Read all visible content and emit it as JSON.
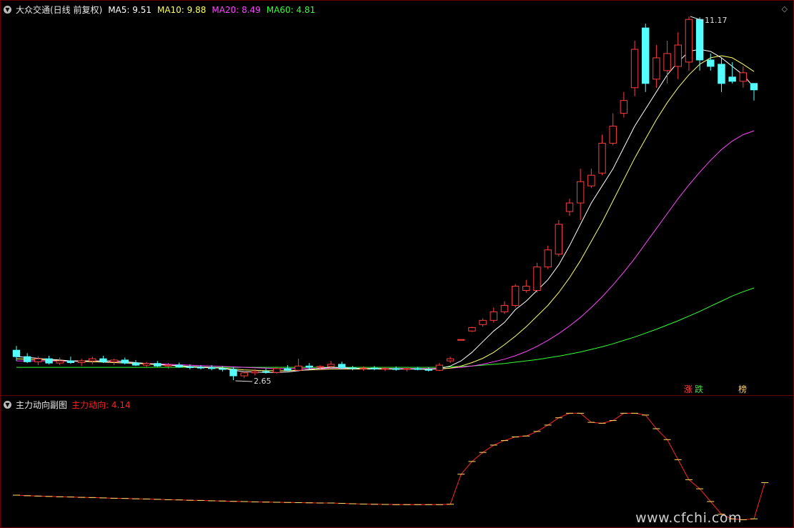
{
  "main": {
    "title": "大众交通(日线 前复权)",
    "ma": [
      {
        "label": "MA5: 9.51",
        "color": "#ffffff"
      },
      {
        "label": "MA10: 9.88",
        "color": "#ffff66"
      },
      {
        "label": "MA20: 8.49",
        "color": "#ff44ff"
      },
      {
        "label": "MA60: 4.81",
        "color": "#33ff33"
      }
    ],
    "high_label": "11.17",
    "low_label": "2.65",
    "badges": [
      {
        "text": "涨",
        "color": "#ff4444"
      },
      {
        "text": "跌",
        "color": "#44dd44"
      },
      {
        "text": "榜",
        "color": "#ffcc66"
      }
    ],
    "corner_icon": "diamond-icon"
  },
  "sub": {
    "title": "主力动向副图",
    "indicator_label": "主力动向: 4.14",
    "indicator_color": "#ff2222"
  },
  "watermark": "www.cfchi.com",
  "colors": {
    "up": "#ff3c3c",
    "down": "#54ffff",
    "border": "#6a0000"
  },
  "chart_data": {
    "type": "candlestick",
    "price_range": [
      2.65,
      11.17
    ],
    "candles": [
      {
        "o": 3.35,
        "h": 3.45,
        "l": 3.1,
        "c": 3.2
      },
      {
        "o": 3.2,
        "h": 3.28,
        "l": 3.05,
        "c": 3.08
      },
      {
        "o": 3.08,
        "h": 3.2,
        "l": 3.0,
        "c": 3.15
      },
      {
        "o": 3.15,
        "h": 3.22,
        "l": 3.02,
        "c": 3.05
      },
      {
        "o": 3.05,
        "h": 3.18,
        "l": 3.0,
        "c": 3.1
      },
      {
        "o": 3.1,
        "h": 3.2,
        "l": 3.03,
        "c": 3.06
      },
      {
        "o": 3.06,
        "h": 3.15,
        "l": 2.98,
        "c": 3.1
      },
      {
        "o": 3.1,
        "h": 3.2,
        "l": 3.02,
        "c": 3.15
      },
      {
        "o": 3.15,
        "h": 3.22,
        "l": 3.05,
        "c": 3.08
      },
      {
        "o": 3.08,
        "h": 3.15,
        "l": 3.0,
        "c": 3.12
      },
      {
        "o": 3.12,
        "h": 3.18,
        "l": 3.02,
        "c": 3.05
      },
      {
        "o": 3.05,
        "h": 3.12,
        "l": 2.98,
        "c": 3.0
      },
      {
        "o": 3.0,
        "h": 3.08,
        "l": 2.95,
        "c": 3.04
      },
      {
        "o": 3.04,
        "h": 3.1,
        "l": 2.96,
        "c": 2.98
      },
      {
        "o": 2.98,
        "h": 3.05,
        "l": 2.92,
        "c": 3.0
      },
      {
        "o": 3.0,
        "h": 3.06,
        "l": 2.94,
        "c": 2.96
      },
      {
        "o": 2.96,
        "h": 3.02,
        "l": 2.9,
        "c": 2.95
      },
      {
        "o": 2.95,
        "h": 3.0,
        "l": 2.9,
        "c": 2.94
      },
      {
        "o": 2.94,
        "h": 3.0,
        "l": 2.88,
        "c": 2.92
      },
      {
        "o": 2.92,
        "h": 2.98,
        "l": 2.85,
        "c": 2.9
      },
      {
        "o": 2.9,
        "h": 2.95,
        "l": 2.65,
        "c": 2.75
      },
      {
        "o": 2.75,
        "h": 2.85,
        "l": 2.7,
        "c": 2.82
      },
      {
        "o": 2.82,
        "h": 2.9,
        "l": 2.76,
        "c": 2.85
      },
      {
        "o": 2.85,
        "h": 2.92,
        "l": 2.8,
        "c": 2.83
      },
      {
        "o": 2.83,
        "h": 2.95,
        "l": 2.8,
        "c": 2.92
      },
      {
        "o": 2.92,
        "h": 3.0,
        "l": 2.86,
        "c": 2.88
      },
      {
        "o": 2.88,
        "h": 3.15,
        "l": 2.85,
        "c": 2.98
      },
      {
        "o": 2.98,
        "h": 3.05,
        "l": 2.9,
        "c": 2.95
      },
      {
        "o": 2.95,
        "h": 3.0,
        "l": 2.88,
        "c": 2.97
      },
      {
        "o": 2.97,
        "h": 3.1,
        "l": 2.92,
        "c": 3.02
      },
      {
        "o": 3.02,
        "h": 3.08,
        "l": 2.9,
        "c": 2.94
      },
      {
        "o": 2.94,
        "h": 2.98,
        "l": 2.88,
        "c": 2.92
      },
      {
        "o": 2.92,
        "h": 2.97,
        "l": 2.87,
        "c": 2.93
      },
      {
        "o": 2.93,
        "h": 2.98,
        "l": 2.88,
        "c": 2.91
      },
      {
        "o": 2.91,
        "h": 2.96,
        "l": 2.86,
        "c": 2.92
      },
      {
        "o": 2.92,
        "h": 2.97,
        "l": 2.87,
        "c": 2.9
      },
      {
        "o": 2.9,
        "h": 2.95,
        "l": 2.85,
        "c": 2.92
      },
      {
        "o": 2.92,
        "h": 2.96,
        "l": 2.88,
        "c": 2.9
      },
      {
        "o": 2.9,
        "h": 2.95,
        "l": 2.85,
        "c": 2.88
      },
      {
        "o": 2.88,
        "h": 3.05,
        "l": 2.86,
        "c": 3.0
      },
      {
        "o": 3.1,
        "h": 3.2,
        "l": 3.05,
        "c": 3.15
      },
      {
        "o": 3.6,
        "h": 3.6,
        "l": 3.6,
        "c": 3.6
      },
      {
        "o": 3.8,
        "h": 3.9,
        "l": 3.78,
        "c": 3.88
      },
      {
        "o": 3.95,
        "h": 4.1,
        "l": 3.9,
        "c": 4.05
      },
      {
        "o": 4.05,
        "h": 4.35,
        "l": 4.0,
        "c": 4.25
      },
      {
        "o": 4.25,
        "h": 4.5,
        "l": 4.2,
        "c": 4.4
      },
      {
        "o": 4.4,
        "h": 4.9,
        "l": 4.35,
        "c": 4.85
      },
      {
        "o": 4.75,
        "h": 5.0,
        "l": 4.7,
        "c": 4.85
      },
      {
        "o": 4.75,
        "h": 5.4,
        "l": 4.7,
        "c": 5.3
      },
      {
        "o": 5.3,
        "h": 5.8,
        "l": 5.25,
        "c": 5.7
      },
      {
        "o": 5.6,
        "h": 6.4,
        "l": 5.55,
        "c": 6.3
      },
      {
        "o": 6.6,
        "h": 6.9,
        "l": 6.5,
        "c": 6.8
      },
      {
        "o": 6.8,
        "h": 7.6,
        "l": 6.4,
        "c": 7.3
      },
      {
        "o": 7.2,
        "h": 7.6,
        "l": 7.15,
        "c": 7.45
      },
      {
        "o": 7.5,
        "h": 8.4,
        "l": 7.45,
        "c": 8.2
      },
      {
        "o": 8.2,
        "h": 8.9,
        "l": 8.15,
        "c": 8.6
      },
      {
        "o": 8.9,
        "h": 9.4,
        "l": 8.8,
        "c": 9.2
      },
      {
        "o": 9.5,
        "h": 10.6,
        "l": 9.3,
        "c": 10.4
      },
      {
        "o": 10.9,
        "h": 11.0,
        "l": 9.4,
        "c": 9.6
      },
      {
        "o": 9.7,
        "h": 10.5,
        "l": 9.5,
        "c": 10.2
      },
      {
        "o": 9.9,
        "h": 10.6,
        "l": 9.6,
        "c": 10.3
      },
      {
        "o": 10.0,
        "h": 10.8,
        "l": 9.7,
        "c": 10.5
      },
      {
        "o": 10.1,
        "h": 11.17,
        "l": 9.9,
        "c": 11.1
      },
      {
        "o": 11.1,
        "h": 11.15,
        "l": 9.9,
        "c": 10.15
      },
      {
        "o": 10.15,
        "h": 10.3,
        "l": 9.9,
        "c": 10.0
      },
      {
        "o": 10.05,
        "h": 10.2,
        "l": 9.4,
        "c": 9.6
      },
      {
        "o": 9.75,
        "h": 10.1,
        "l": 9.6,
        "c": 9.65
      },
      {
        "o": 9.65,
        "h": 10.0,
        "l": 9.5,
        "c": 9.85
      },
      {
        "o": 9.6,
        "h": 9.6,
        "l": 9.2,
        "c": 9.45
      }
    ],
    "ma5": [
      3.2,
      3.18,
      3.16,
      3.14,
      3.12,
      3.1,
      3.1,
      3.1,
      3.1,
      3.1,
      3.08,
      3.06,
      3.04,
      3.02,
      3.0,
      2.99,
      2.97,
      2.96,
      2.95,
      2.93,
      2.88,
      2.85,
      2.84,
      2.83,
      2.83,
      2.84,
      2.87,
      2.9,
      2.93,
      2.95,
      2.94,
      2.93,
      2.92,
      2.92,
      2.92,
      2.91,
      2.91,
      2.91,
      2.9,
      2.92,
      2.98,
      3.1,
      3.3,
      3.55,
      3.8,
      4.0,
      4.3,
      4.5,
      4.75,
      5.0,
      5.35,
      5.8,
      6.3,
      6.8,
      7.2,
      7.6,
      8.1,
      8.6,
      9.0,
      9.4,
      9.8,
      10.1,
      10.35,
      10.4,
      10.35,
      10.2,
      10.0,
      9.8,
      9.51
    ],
    "ma10": [
      3.15,
      3.14,
      3.13,
      3.12,
      3.11,
      3.1,
      3.09,
      3.08,
      3.07,
      3.06,
      3.05,
      3.04,
      3.03,
      3.01,
      3.0,
      2.98,
      2.96,
      2.95,
      2.94,
      2.93,
      2.91,
      2.89,
      2.88,
      2.87,
      2.87,
      2.87,
      2.88,
      2.89,
      2.9,
      2.91,
      2.91,
      2.91,
      2.91,
      2.91,
      2.91,
      2.91,
      2.91,
      2.91,
      2.91,
      2.91,
      2.93,
      2.98,
      3.06,
      3.16,
      3.3,
      3.48,
      3.68,
      3.9,
      4.15,
      4.4,
      4.7,
      5.05,
      5.45,
      5.9,
      6.35,
      6.85,
      7.35,
      7.85,
      8.3,
      8.75,
      9.15,
      9.5,
      9.8,
      10.05,
      10.2,
      10.25,
      10.2,
      10.05,
      9.88
    ],
    "ma20": [
      3.1,
      3.1,
      3.1,
      3.1,
      3.1,
      3.09,
      3.09,
      3.08,
      3.08,
      3.07,
      3.06,
      3.05,
      3.04,
      3.03,
      3.02,
      3.01,
      3.0,
      2.99,
      2.98,
      2.97,
      2.96,
      2.95,
      2.94,
      2.93,
      2.92,
      2.92,
      2.92,
      2.92,
      2.92,
      2.92,
      2.92,
      2.92,
      2.92,
      2.92,
      2.92,
      2.92,
      2.92,
      2.92,
      2.92,
      2.92,
      2.93,
      2.95,
      2.98,
      3.02,
      3.08,
      3.14,
      3.22,
      3.32,
      3.44,
      3.58,
      3.74,
      3.92,
      4.12,
      4.35,
      4.6,
      4.88,
      5.18,
      5.5,
      5.85,
      6.2,
      6.55,
      6.9,
      7.22,
      7.52,
      7.8,
      8.05,
      8.25,
      8.4,
      8.49
    ],
    "ma60": [
      2.95,
      2.95,
      2.95,
      2.95,
      2.95,
      2.95,
      2.95,
      2.95,
      2.95,
      2.95,
      2.95,
      2.95,
      2.95,
      2.95,
      2.95,
      2.95,
      2.95,
      2.95,
      2.95,
      2.95,
      2.95,
      2.95,
      2.95,
      2.95,
      2.95,
      2.95,
      2.95,
      2.95,
      2.95,
      2.95,
      2.95,
      2.95,
      2.95,
      2.95,
      2.95,
      2.95,
      2.95,
      2.95,
      2.95,
      2.95,
      2.96,
      2.97,
      2.98,
      3.0,
      3.02,
      3.04,
      3.07,
      3.1,
      3.13,
      3.17,
      3.21,
      3.26,
      3.31,
      3.37,
      3.43,
      3.5,
      3.58,
      3.66,
      3.75,
      3.84,
      3.94,
      4.04,
      4.15,
      4.26,
      4.38,
      4.5,
      4.62,
      4.72,
      4.81
    ],
    "indicator": [
      3.45,
      3.42,
      3.4,
      3.38,
      3.36,
      3.35,
      3.33,
      3.32,
      3.3,
      3.28,
      3.27,
      3.25,
      3.24,
      3.22,
      3.2,
      3.19,
      3.17,
      3.16,
      3.14,
      3.13,
      3.11,
      3.1,
      3.08,
      3.07,
      3.06,
      3.05,
      3.04,
      3.03,
      3.02,
      3.02,
      3.0,
      2.98,
      2.96,
      2.95,
      2.94,
      2.93,
      2.93,
      2.93,
      2.93,
      2.93,
      2.95,
      4.6,
      5.3,
      5.8,
      6.2,
      6.45,
      6.65,
      6.7,
      6.95,
      7.3,
      7.7,
      7.95,
      7.95,
      7.45,
      7.4,
      7.55,
      7.95,
      7.95,
      7.85,
      7.1,
      6.5,
      5.4,
      4.3,
      3.8,
      3.1,
      2.4,
      2.15,
      2.1,
      2.15,
      4.14
    ]
  }
}
